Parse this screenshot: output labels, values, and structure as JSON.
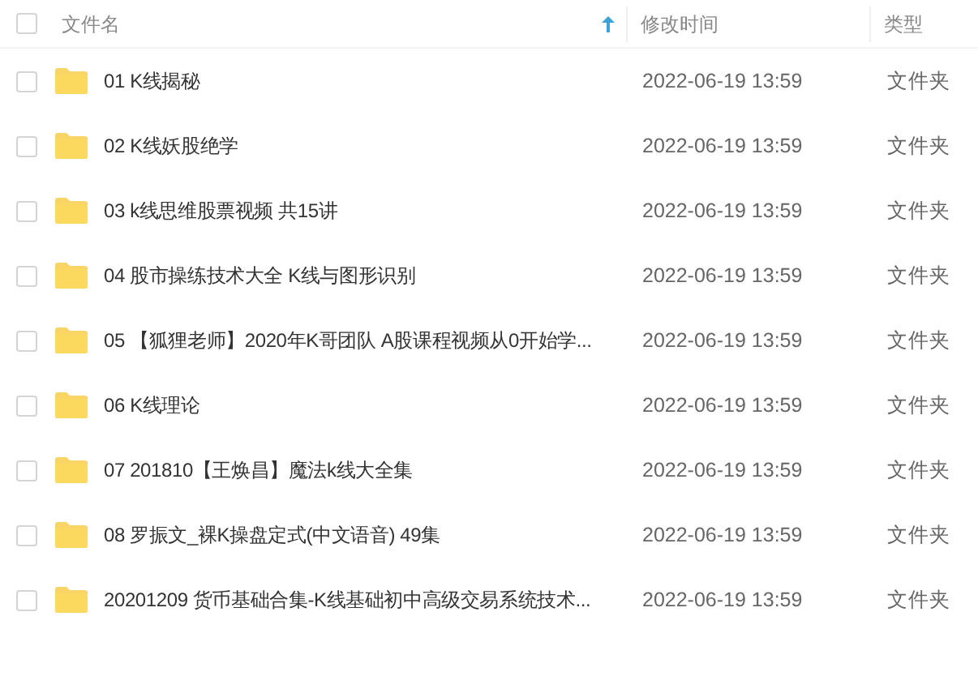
{
  "header": {
    "checked": false,
    "columns": [
      {
        "label": "文件名",
        "sorted": true
      },
      {
        "label": "修改时间",
        "sorted": false
      },
      {
        "label": "类型",
        "sorted": false
      }
    ]
  },
  "rows": [
    {
      "name": "01 K线揭秘",
      "modified": "2022-06-19 13:59",
      "type": "文件夹",
      "checked": false
    },
    {
      "name": "02 K线妖股绝学",
      "modified": "2022-06-19 13:59",
      "type": "文件夹",
      "checked": false
    },
    {
      "name": "03 k线思维股票视频  共15讲",
      "modified": "2022-06-19 13:59",
      "type": "文件夹",
      "checked": false
    },
    {
      "name": "04 股市操练技术大全 K线与图形识别",
      "modified": "2022-06-19 13:59",
      "type": "文件夹",
      "checked": false
    },
    {
      "name": "05 【狐狸老师】2020年K哥团队 A股课程视频从0开始学...",
      "modified": "2022-06-19 13:59",
      "type": "文件夹",
      "checked": false
    },
    {
      "name": "06 K线理论",
      "modified": "2022-06-19 13:59",
      "type": "文件夹",
      "checked": false
    },
    {
      "name": "07 201810【王焕昌】魔法k线大全集",
      "modified": "2022-06-19 13:59",
      "type": "文件夹",
      "checked": false
    },
    {
      "name": "08 罗振文_裸K操盘定式(中文语音)  49集",
      "modified": "2022-06-19 13:59",
      "type": "文件夹",
      "checked": false
    },
    {
      "name": "20201209 货币基础合集-K线基础初中高级交易系统技术...",
      "modified": "2022-06-19 13:59",
      "type": "文件夹",
      "checked": false
    }
  ]
}
